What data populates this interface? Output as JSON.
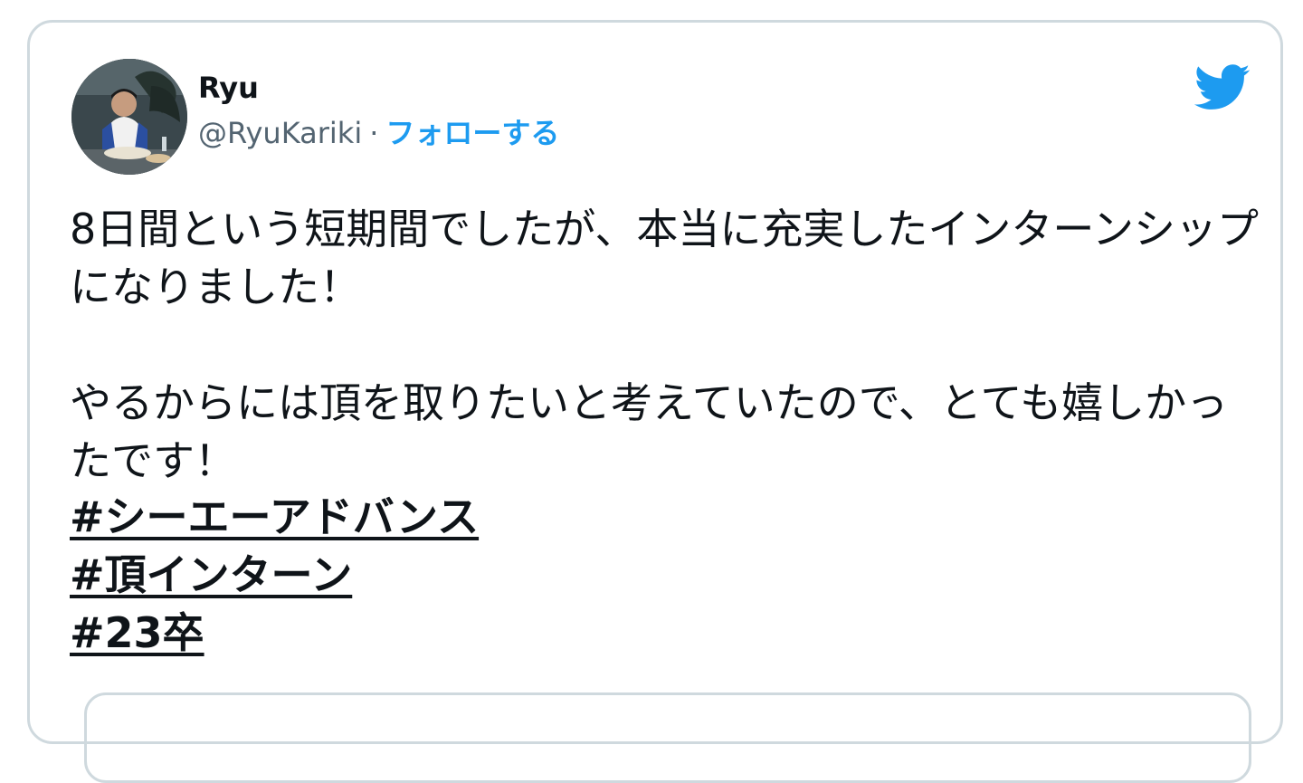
{
  "tweet": {
    "author": {
      "name": "Ryu",
      "handle": "@RyuKariki",
      "separator": "·",
      "follow_label": "フォローする"
    },
    "icons": {
      "brand": "twitter-bird-icon",
      "brand_color": "#1d9bf0"
    },
    "text": "8日間という短期間でしたが、本当に充実したインターンシップになりました！\n\nやるからには頂を取りたいと考えていたので、とても嬉しかったです！",
    "hashtags": [
      "#シーエーアドバンス",
      "#頂インターン",
      "#23卒"
    ]
  }
}
